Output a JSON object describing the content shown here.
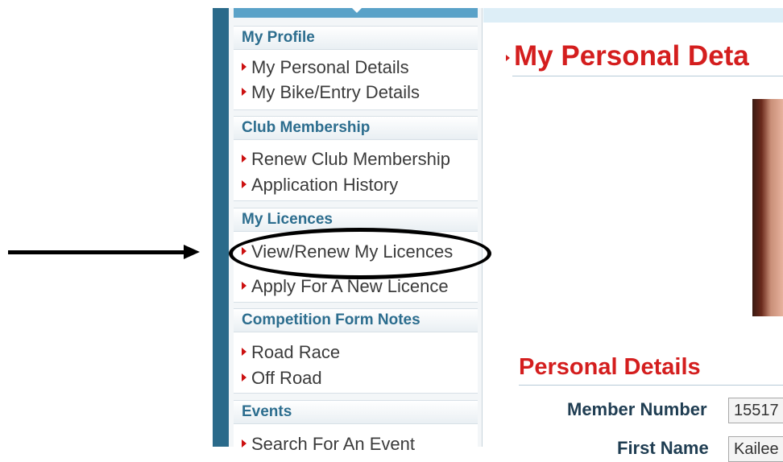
{
  "sidebar": {
    "sections": [
      {
        "title": "My Profile",
        "items": [
          "My Personal Details",
          "My Bike/Entry Details"
        ]
      },
      {
        "title": "Club Membership",
        "items": [
          "Renew Club Membership",
          "Application History"
        ]
      },
      {
        "title": "My Licences",
        "items": [
          "View/Renew My Licences",
          "Apply For A New Licence"
        ]
      },
      {
        "title": "Competition Form Notes",
        "items": [
          "Road Race",
          "Off Road"
        ]
      },
      {
        "title": "Events",
        "items": [
          "Search For An Event"
        ]
      }
    ]
  },
  "main": {
    "page_title": "My Personal Deta",
    "section_title": "Personal Details",
    "fields": [
      {
        "label": "Member Number",
        "value": "15517"
      },
      {
        "label": "First Name",
        "value": "Kailee"
      }
    ]
  },
  "annotation": {
    "arrow_icon": "arrow-right-icon",
    "highlight": "ellipse-highlight"
  },
  "colors": {
    "brand_blue": "#2c6d8e",
    "accent_red": "#d41e1e",
    "frame_bar": "#2a6a8a"
  }
}
